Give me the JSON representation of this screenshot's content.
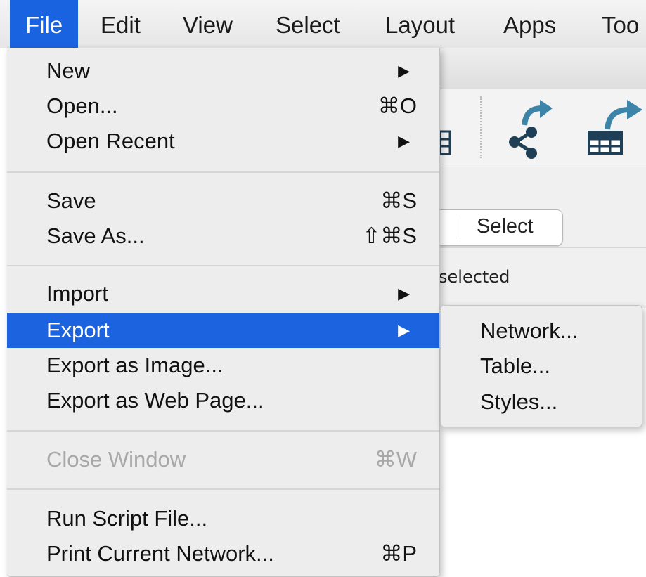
{
  "menubar": {
    "items": [
      "File",
      "Edit",
      "View",
      "Select",
      "Layout",
      "Apps",
      "Too"
    ]
  },
  "file_menu": {
    "new": {
      "label": "New"
    },
    "open": {
      "label": "Open...",
      "shortcut": "⌘O"
    },
    "open_recent": {
      "label": "Open Recent"
    },
    "save": {
      "label": "Save",
      "shortcut": "⌘S"
    },
    "save_as": {
      "label": "Save As...",
      "shortcut": "⇧⌘S"
    },
    "import": {
      "label": "Import"
    },
    "export": {
      "label": "Export"
    },
    "export_image": {
      "label": "Export as Image..."
    },
    "export_web": {
      "label": "Export as Web Page..."
    },
    "close_window": {
      "label": "Close Window",
      "shortcut": "⌘W"
    },
    "run_script": {
      "label": "Run Script File..."
    },
    "print_network": {
      "label": "Print Current Network...",
      "shortcut": "⌘P"
    },
    "submenu_arrow": "▶"
  },
  "export_submenu": {
    "items": [
      "Network...",
      "Table...",
      "Styles..."
    ]
  },
  "background": {
    "select_button": "Select",
    "status_text": "selected"
  },
  "colors": {
    "highlight": "#1b63df",
    "icon_teal": "#3c84a8",
    "icon_dark": "#1e3f55"
  }
}
